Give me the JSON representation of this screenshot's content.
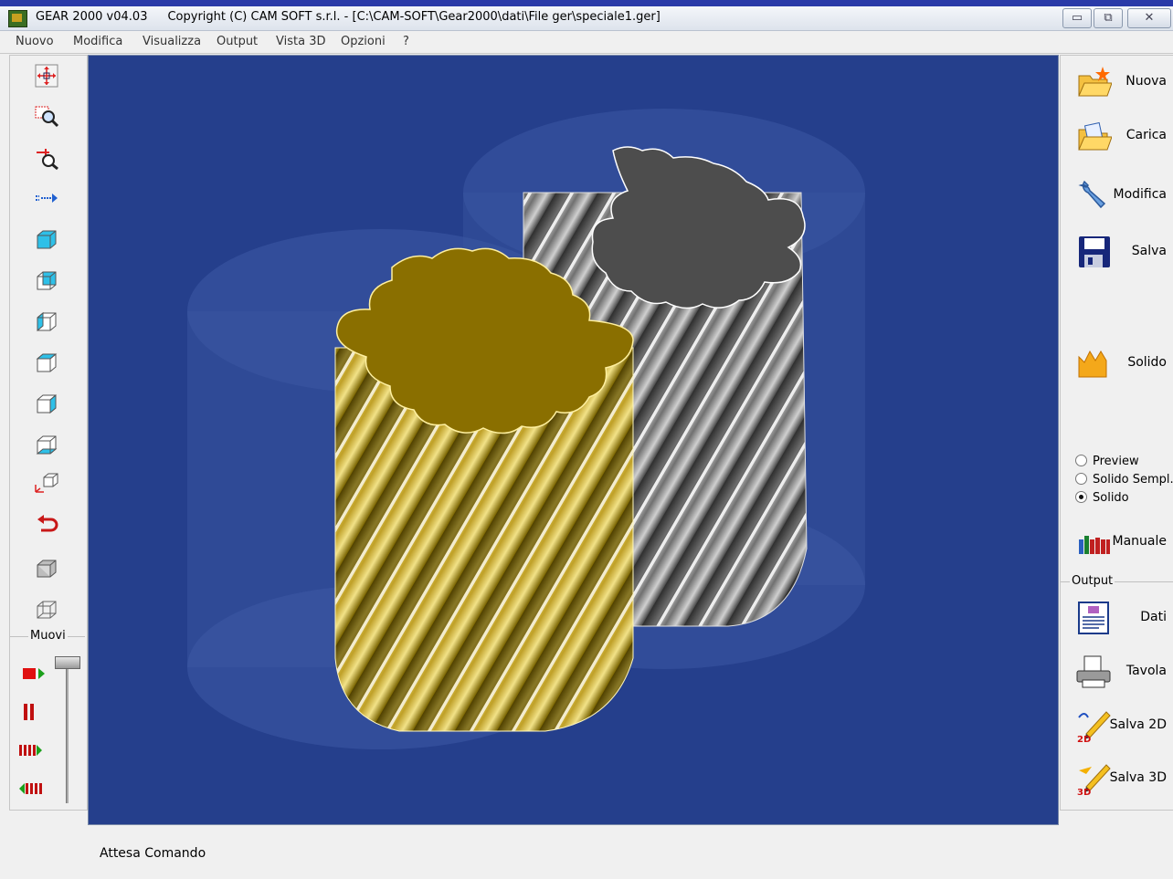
{
  "window": {
    "app_name": "GEAR 2000 v04.03",
    "title_rest": "Copyright (C)  CAM SOFT s.r.l. - [C:\\CAM-SOFT\\Gear2000\\dati\\File ger\\speciale1.ger]",
    "controls": {
      "minimize": "▭",
      "restore": "⧉",
      "close": "✕"
    }
  },
  "menu": [
    "Nuovo",
    "Modifica",
    "Visualizza",
    "Output",
    "Vista 3D",
    "Opzioni",
    "?"
  ],
  "left_toolbar": {
    "tools": [
      {
        "name": "pan-icon"
      },
      {
        "name": "zoom-window-icon"
      },
      {
        "name": "zoom-in-out-icon"
      },
      {
        "name": "arrow-right-icon"
      },
      {
        "name": "view-iso-1-icon"
      },
      {
        "name": "view-iso-2-icon"
      },
      {
        "name": "view-iso-3-icon"
      },
      {
        "name": "view-iso-4-icon"
      },
      {
        "name": "view-iso-5-icon"
      },
      {
        "name": "view-iso-6-icon"
      },
      {
        "name": "axes-view-icon"
      },
      {
        "name": "undo-rotate-icon"
      },
      {
        "name": "solid-box-icon"
      },
      {
        "name": "wire-box-icon"
      }
    ],
    "muovi_label": "Muovi",
    "muovi_buttons": [
      {
        "name": "stop-play-icon"
      },
      {
        "name": "pause-icon"
      },
      {
        "name": "forward-icon"
      },
      {
        "name": "rewind-icon"
      }
    ]
  },
  "right_panel": {
    "buttons": [
      {
        "label": "Nuova",
        "icon": "new-folder-icon"
      },
      {
        "label": "Carica",
        "icon": "open-folder-icon"
      },
      {
        "label": "Modifica",
        "icon": "wrench-icon"
      },
      {
        "label": "Salva",
        "icon": "floppy-icon"
      },
      {
        "label": "Solido",
        "icon": "solid-icon"
      }
    ],
    "render_modes": [
      {
        "label": "Preview",
        "checked": false
      },
      {
        "label": "Solido Sempl.",
        "checked": false
      },
      {
        "label": "Solido",
        "checked": true
      }
    ],
    "manuale": "Manuale",
    "output_label": "Output",
    "output_buttons": [
      {
        "label": "Dati",
        "icon": "data-sheet-icon"
      },
      {
        "label": "Tavola",
        "icon": "printer-icon"
      },
      {
        "label": "Salva 2D",
        "icon": "pencil-2d-icon"
      },
      {
        "label": "Salva 3D",
        "icon": "pencil-3d-icon"
      }
    ]
  },
  "status": "Attesa Comando",
  "colors": {
    "viewport_bg": "#253f8c",
    "gear_gold": "#c9a825",
    "gear_gold_top": "#8a6f00",
    "gear_gray": "#8a8a8a",
    "gear_gray_top": "#4d4d4d"
  }
}
